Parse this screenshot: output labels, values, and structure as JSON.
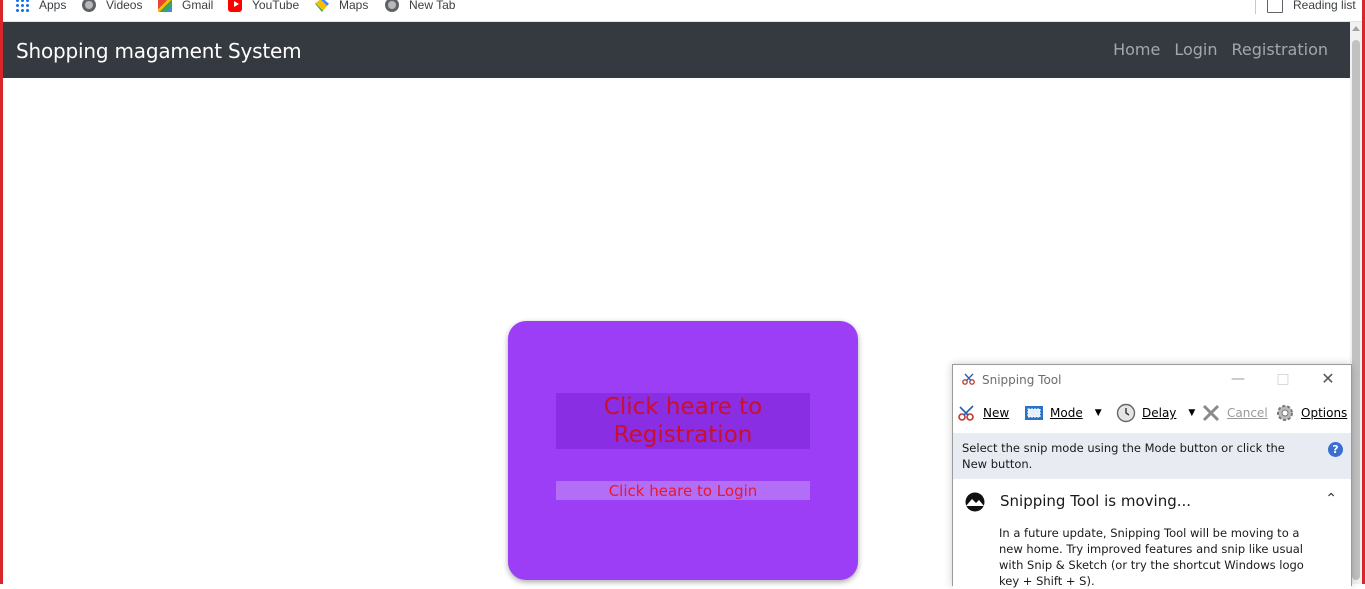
{
  "bookmarks": {
    "items": [
      {
        "label": "Apps",
        "icon": "apps-icon"
      },
      {
        "label": "Videos",
        "icon": "globe-icon"
      },
      {
        "label": "Gmail",
        "icon": "gmail-icon"
      },
      {
        "label": "YouTube",
        "icon": "youtube-icon"
      },
      {
        "label": "Maps",
        "icon": "maps-icon"
      },
      {
        "label": "New Tab",
        "icon": "globe-icon"
      }
    ],
    "reading_list": "Reading list"
  },
  "navbar": {
    "brand": "Shopping magament System",
    "links": [
      "Home",
      "Login",
      "Registration"
    ],
    "background": "#343a40"
  },
  "card": {
    "registration_label": "Click heare to Registration",
    "login_label": "Click heare to Login",
    "background": "#9c3ef6",
    "text_color": "#c8102e"
  },
  "snipping_tool": {
    "title": "Snipping Tool",
    "toolbar": {
      "new": "New",
      "mode": "Mode",
      "delay": "Delay",
      "cancel": "Cancel",
      "options": "Options"
    },
    "hint": "Select the snip mode using the Mode button or click the New button.",
    "notice_title": "Snipping Tool is moving...",
    "notice_body": "In a future update, Snipping Tool will be moving to a new home. Try improved features and snip like usual with Snip & Sketch (or try the shortcut Windows logo key + Shift + S)."
  }
}
